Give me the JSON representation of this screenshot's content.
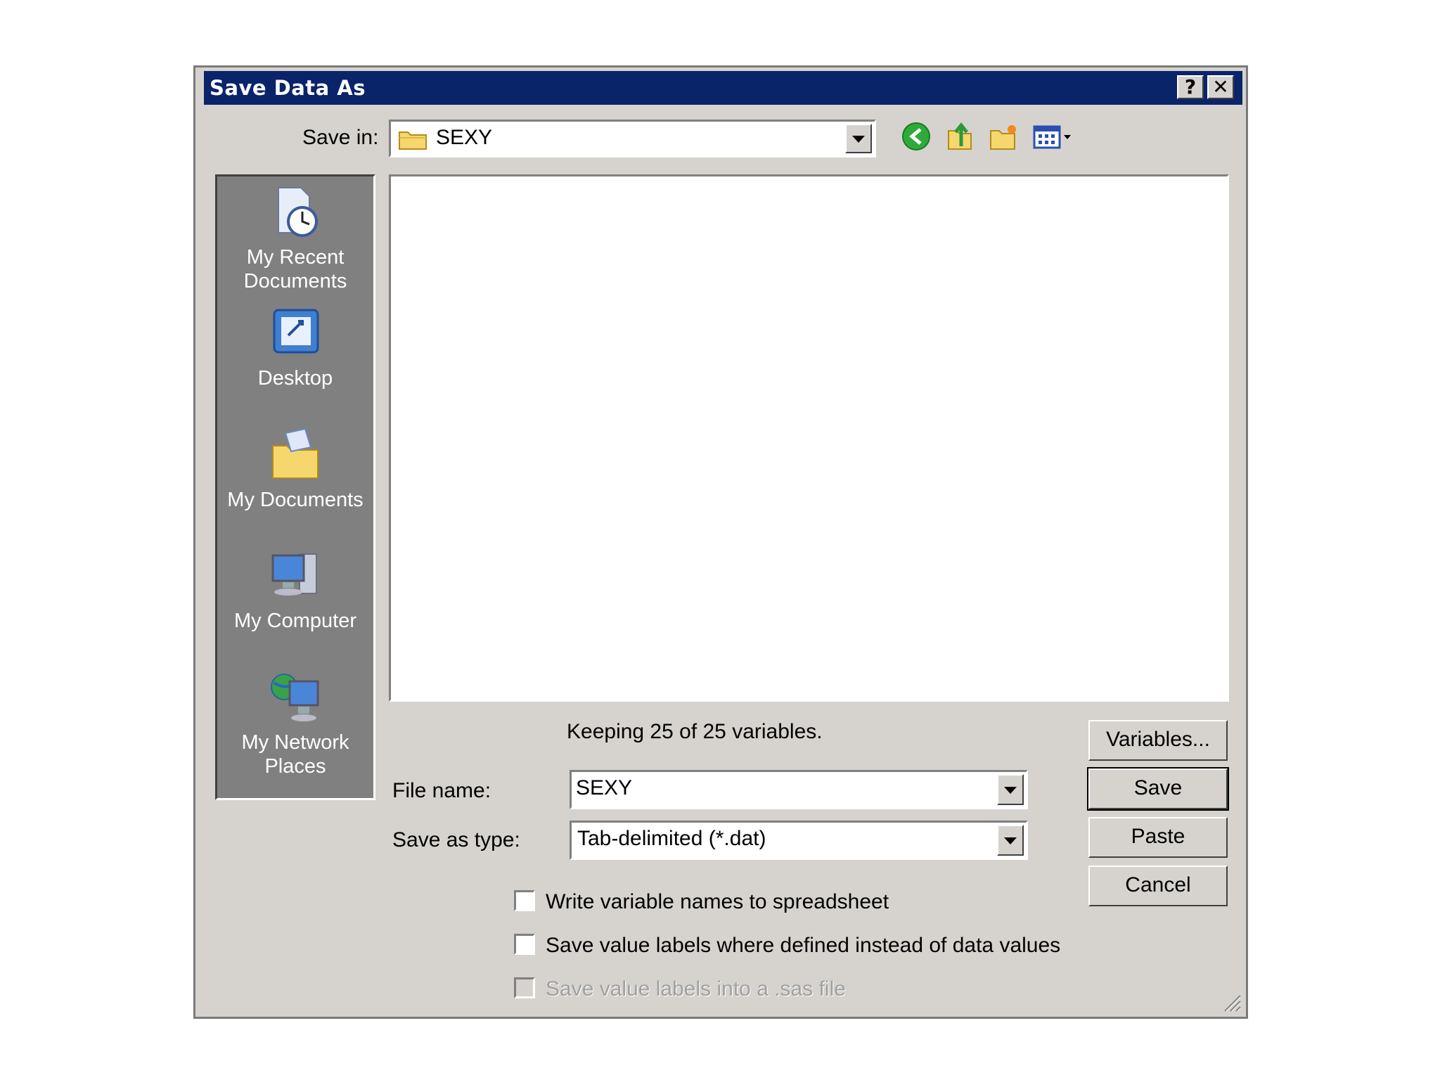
{
  "window": {
    "title": "Save Data As",
    "help_label": "?",
    "close_label": "✕"
  },
  "save_in": {
    "label": "Save in:",
    "value": "SEXY"
  },
  "toolbar": {
    "back_icon": "back-arrow-icon",
    "up_icon": "up-folder-icon",
    "new_folder_icon": "new-folder-icon",
    "views_icon": "views-menu-icon"
  },
  "places": [
    {
      "id": "recent",
      "label_line1": "My Recent",
      "label_line2": "Documents",
      "icon": "recent-documents-icon"
    },
    {
      "id": "desktop",
      "label_line1": "Desktop",
      "label_line2": "",
      "icon": "desktop-icon"
    },
    {
      "id": "mydocs",
      "label_line1": "My Documents",
      "label_line2": "",
      "icon": "my-documents-icon"
    },
    {
      "id": "mycomputer",
      "label_line1": "My Computer",
      "label_line2": "",
      "icon": "my-computer-icon"
    },
    {
      "id": "network",
      "label_line1": "My Network",
      "label_line2": "Places",
      "icon": "network-places-icon"
    }
  ],
  "status": "Keeping 25 of 25 variables.",
  "file_name": {
    "label": "File name:",
    "value": "SEXY"
  },
  "save_type": {
    "label": "Save as type:",
    "value": "Tab-delimited (*.dat)"
  },
  "buttons": {
    "variables": "Variables...",
    "save": "Save",
    "paste": "Paste",
    "cancel": "Cancel"
  },
  "options": {
    "write_names": {
      "label": "Write variable names to spreadsheet",
      "checked": false
    },
    "value_labels": {
      "label": "Save value labels where defined instead of data values",
      "checked": false
    },
    "sas_file": {
      "label": "Save value labels into a .sas file",
      "checked": false,
      "disabled": true
    }
  },
  "colors": {
    "titlebar": "#0a246a",
    "dialog": "#d6d3ce",
    "places_bg": "#808080"
  }
}
